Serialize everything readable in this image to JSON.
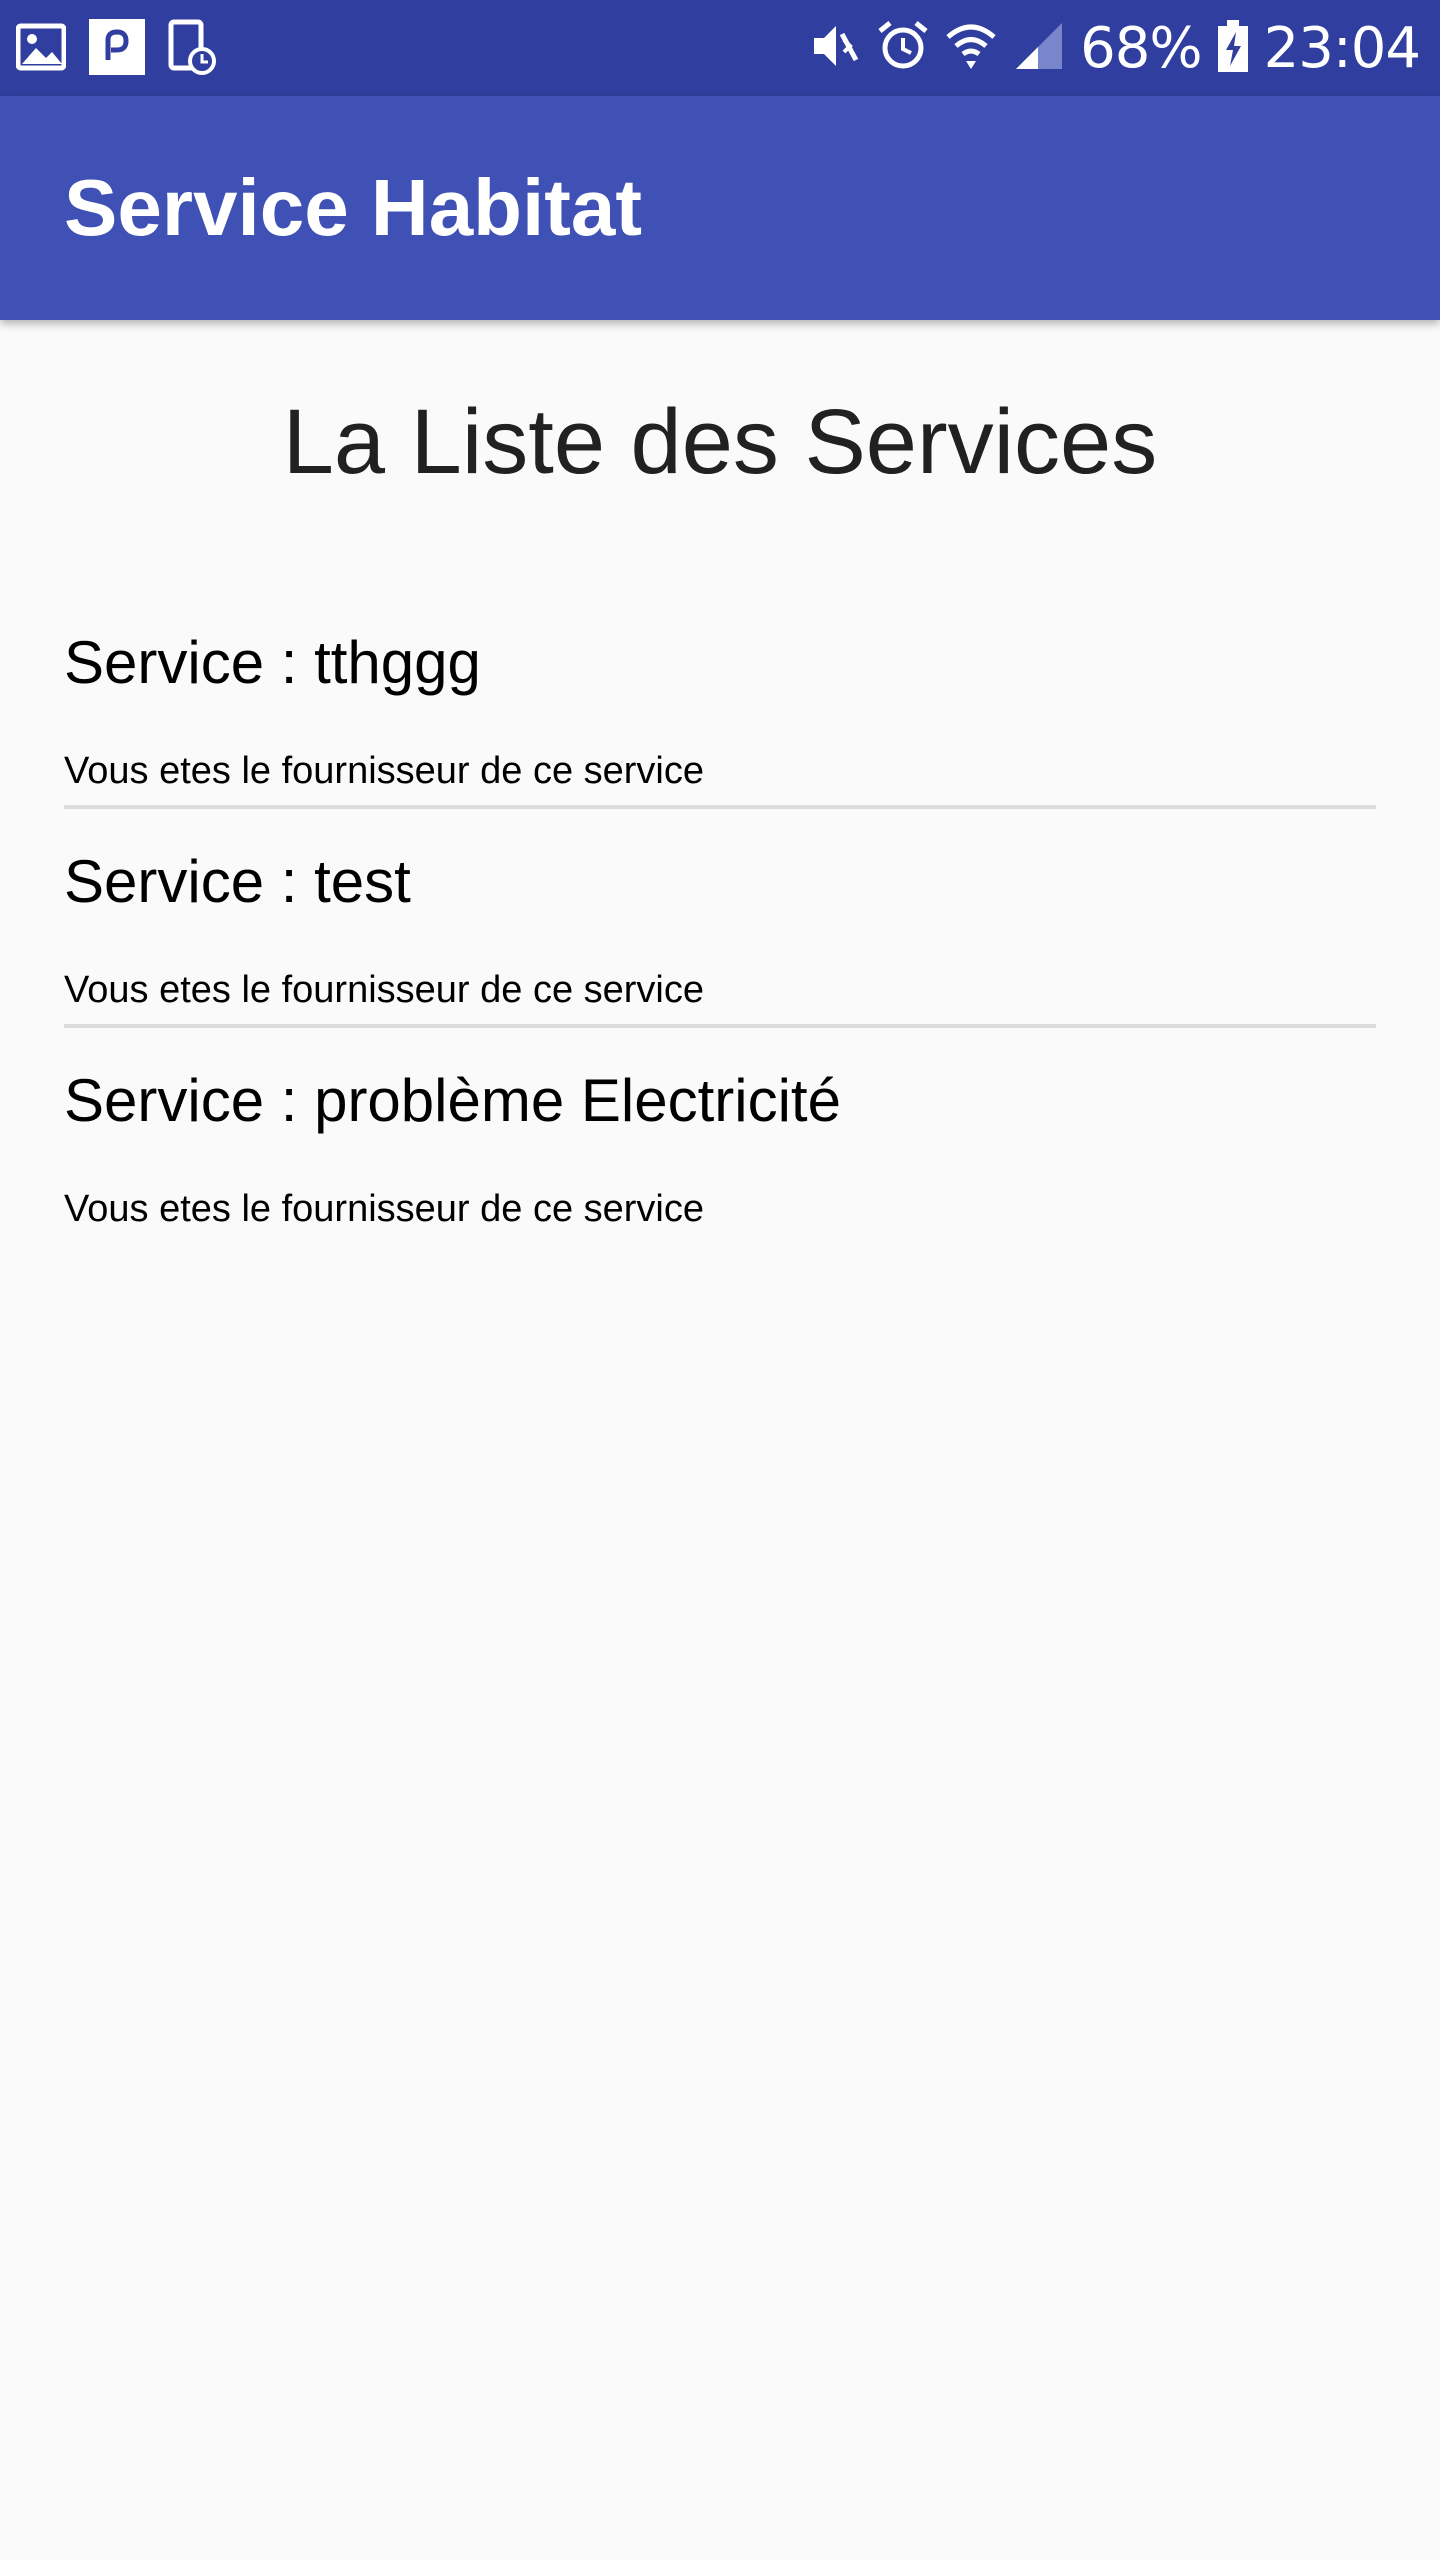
{
  "status_bar": {
    "left_icons": [
      "gallery-notification-icon",
      "pocket-app-icon",
      "screen-time-icon"
    ],
    "right_icons": [
      "vibrate-mute-icon",
      "alarm-icon",
      "wifi-icon",
      "signal-icon",
      "battery-charging-icon"
    ],
    "battery": "68%",
    "time": "23:04",
    "color": "#303f9f"
  },
  "app_bar": {
    "title": "Service Habitat",
    "color": "#3f51b5"
  },
  "main": {
    "heading": "La Liste des Services",
    "services": [
      {
        "title": "Service : tthggg",
        "subtitle": "Vous etes le fournisseur de ce service"
      },
      {
        "title": "Service : test",
        "subtitle": "Vous etes le fournisseur de ce service"
      },
      {
        "title": "Service : problème Electricité",
        "subtitle": "Vous etes le fournisseur de ce service"
      }
    ]
  }
}
